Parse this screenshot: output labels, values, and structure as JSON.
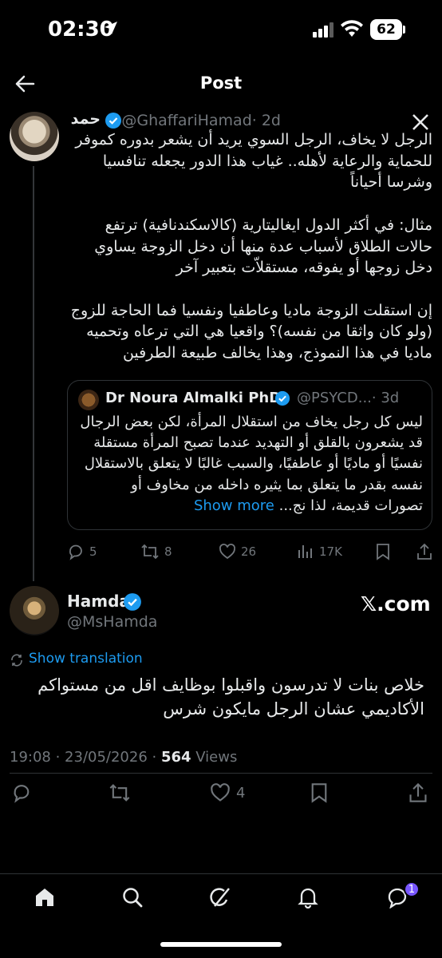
{
  "status_bar": {
    "time": "02:30",
    "battery": "62"
  },
  "header": {
    "title": "Post"
  },
  "tweet1": {
    "name": "حمد",
    "handle": "@GhaffariHamad",
    "time": "· 2d",
    "body": "الرجل لا يخاف، الرجل السوي يريد أن يشعر بدوره كموفر للحماية والرعاية لأهله.. غياب هذا الدور يجعله تنافسيا وشرسا أحياناً\n\nمثال: في أكثر الدول ايغاليتارية (كالاسكندنافية) ترتفع حالات الطلاق لأسباب عدة منها أن دخل الزوجة يساوي دخل زوجها أو يفوقه، مستقلاّت بتعبير آخر\n\nإن استقلت الزوجة ماديا وعاطفيا ونفسيا فما الحاجة للزوج (ولو كان واثقا من نفسه)؟ واقعيا هي التي ترعاه وتحميه ماديا في هذا النموذج، وهذا يخالف طبيعة الطرفين",
    "quote": {
      "name": "Dr Noura Almalki PhD",
      "handle": "@PSYCD...",
      "time": "· 3d",
      "text": "ليس كل رجل يخاف من استقلال المرأة، لكن بعض الرجال قد يشعرون بالقلق أو التهديد عندما تصبح المرأة مستقلة نفسيًا أو ماديًا أو عاطفيًا، والسبب غالبًا لا يتعلق بالاستقلال نفسه بقدر ما يتعلق بما يثيره داخله من مخاوف أو تصورات قديمة، لذا نج...",
      "show_more": "Show more"
    },
    "actions": {
      "replies": "5",
      "reposts": "8",
      "likes": "26",
      "views": "17K"
    }
  },
  "tweet2": {
    "name": "Hamda",
    "handle": "@MsHamda",
    "source": "𝕏.com",
    "translate": "Show translation",
    "body": "خلاص بنات لا تدرسون واقبلوا بوظايف اقل من مستواكم الأكاديمي عشان الرجل مايكون شرس",
    "timestamp": "19:08 · 23/05/2026 · ",
    "views_count": "564",
    "views_label": " Views",
    "likes": "4"
  },
  "nav": {
    "notifications_badge": "1"
  },
  "colors": {
    "accent": "#1d9bf0",
    "verified": "#1d9bf0",
    "badge": "#7856ff",
    "background": "#000000"
  }
}
